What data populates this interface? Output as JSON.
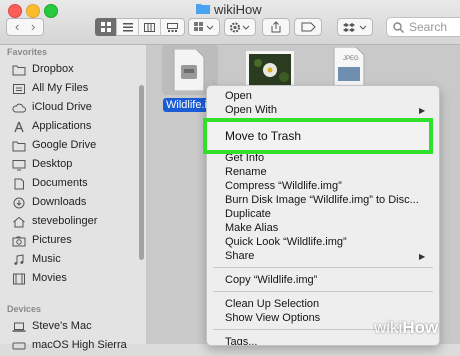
{
  "window": {
    "title": "wikiHow"
  },
  "toolbar": {
    "search_placeholder": "Search"
  },
  "sidebar": {
    "favorites_heading": "Favorites",
    "devices_heading": "Devices",
    "favorites": [
      {
        "label": "Dropbox",
        "icon": "folder-icon"
      },
      {
        "label": "All My Files",
        "icon": "files-icon"
      },
      {
        "label": "iCloud Drive",
        "icon": "cloud-icon"
      },
      {
        "label": "Applications",
        "icon": "applications-icon"
      },
      {
        "label": "Google Drive",
        "icon": "folder-icon"
      },
      {
        "label": "Desktop",
        "icon": "desktop-icon"
      },
      {
        "label": "Documents",
        "icon": "documents-icon"
      },
      {
        "label": "Downloads",
        "icon": "downloads-icon"
      },
      {
        "label": "stevebolinger",
        "icon": "home-icon"
      },
      {
        "label": "Pictures",
        "icon": "camera-icon"
      },
      {
        "label": "Music",
        "icon": "music-icon"
      },
      {
        "label": "Movies",
        "icon": "film-icon"
      }
    ],
    "devices": [
      {
        "label": "Steve's Mac",
        "icon": "laptop-icon"
      },
      {
        "label": "macOS High Sierra",
        "icon": "disk-icon"
      }
    ]
  },
  "files": {
    "selected_name": "Wildlife.img",
    "third_file_tag": "JPEG"
  },
  "context_menu": {
    "open": "Open",
    "open_with": "Open With",
    "move_to_trash": "Move to Trash",
    "get_info": "Get Info",
    "rename": "Rename",
    "compress": "Compress “Wildlife.img”",
    "burn": "Burn Disk Image “Wildlife.img” to Disc...",
    "duplicate": "Duplicate",
    "make_alias": "Make Alias",
    "quick_look": "Quick Look “Wildlife.img”",
    "share": "Share",
    "copy": "Copy “Wildlife.img”",
    "clean_up": "Clean Up Selection",
    "show_view_options": "Show View Options",
    "tags": "Tags..."
  },
  "watermark": {
    "prefix": "wiki",
    "suffix": "How"
  },
  "colors": {
    "highlight_border": "#30e02c",
    "selection": "#1a5bd6"
  }
}
